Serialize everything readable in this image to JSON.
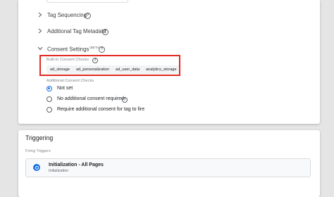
{
  "sections": [
    {
      "label": "Tag Sequencing",
      "expanded": false
    },
    {
      "label": "Additional Tag Metadata",
      "expanded": false
    },
    {
      "label": "Consent Settings",
      "badge": "(BETA)",
      "expanded": true
    }
  ],
  "consent": {
    "built_in_label": "Built-In Consent Checks",
    "built_in_chips": [
      "ad_storage",
      "ad_personalization",
      "ad_user_data",
      "analytics_storage"
    ],
    "additional_label": "Additional Consent Checks",
    "options": [
      {
        "label": "Not set",
        "selected": true
      },
      {
        "label": "No additional consent required",
        "selected": false
      },
      {
        "label": "Require additional consent for tag to fire",
        "selected": false
      }
    ]
  },
  "triggering": {
    "title": "Triggering",
    "firing_label": "Firing Triggers",
    "trigger_name": "Initialization - All Pages",
    "trigger_type": "Initialization"
  },
  "colors": {
    "accent": "#1a73e8",
    "highlight": "#e02a1f"
  },
  "icons": {
    "collapsed": "chevron-right-icon",
    "expanded": "chevron-down-icon",
    "help": "help-circle-icon",
    "trigger": "initialization-trigger-icon"
  }
}
